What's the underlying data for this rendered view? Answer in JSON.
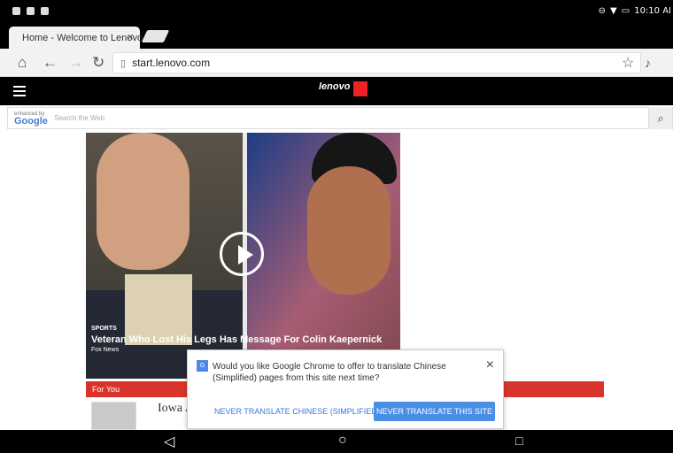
{
  "status_bar": {
    "time": "10:10 AI"
  },
  "tab": {
    "title": "Home - Welcome to Lenovo",
    "favicon_text": "Lenovo"
  },
  "toolbar": {
    "address": "start.lenovo.com"
  },
  "lenovo_bar": {
    "logo": "lenovo"
  },
  "search": {
    "enhanced_by": "enhanced by",
    "brand": "Google",
    "placeholder": "Search the Web"
  },
  "story": {
    "category": "SPORTS",
    "title": "Veteran Who Lost His Legs Has Message For Colin Kaepernick",
    "source": "Fox News"
  },
  "section": {
    "title": "For You"
  },
  "next_story": {
    "title": "Iowa A"
  },
  "translate_dialog": {
    "message": "Would you like Google Chrome to offer to translate Chinese (Simplified) pages from this site next time?",
    "secondary_button": "NEVER TRANSLATE CHINESE (SIMPLIFIED)",
    "primary_button": "NEVER TRANSLATE THIS SITE"
  },
  "colors": {
    "accent_red": "#d9342b",
    "button_blue": "#4a8fe6"
  }
}
